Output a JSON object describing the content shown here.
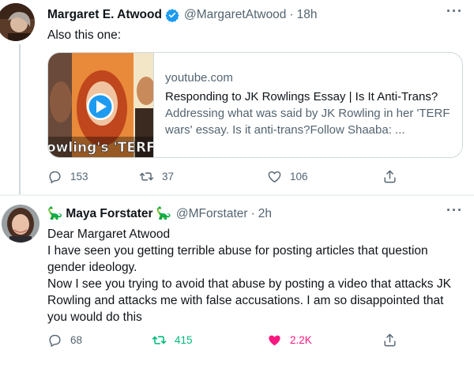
{
  "tweet1": {
    "name": "Margaret E. Atwood",
    "handle": "@MargaretAtwood",
    "separator": "·",
    "time": "18h",
    "more": "···",
    "text": "Also this one:",
    "card": {
      "thumb_text": "owling's 'TERF W",
      "domain": "youtube.com",
      "title": "Responding to JK Rowlings Essay | Is It Anti-Trans?",
      "description_line1": "Addressing what was said by JK Rowling in her 'TERF",
      "description_line2": "wars' essay. Is it anti-trans?Follow Shaaba: ..."
    },
    "actions": {
      "replies": "153",
      "retweets": "37",
      "likes": "106"
    }
  },
  "tweet2": {
    "name": "Maya Forstater",
    "name_emoji_left": "🦕",
    "name_emoji_right": "🦕",
    "handle": "@MForstater",
    "separator": "·",
    "time": "2h",
    "more": "···",
    "lines": [
      "Dear Margaret Atwood",
      "I have seen you getting terrible abuse for posting articles that question gender ideology.",
      "Now I see you trying to avoid that abuse by posting a video that attacks JK Rowling and attacks me with false accusations. I am so disappointed that you would do this"
    ],
    "actions": {
      "replies": "68",
      "retweets": "415",
      "likes": "2.2K"
    }
  },
  "colors": {
    "verified": "#1d9bf0",
    "retweeted": "#00ba7c",
    "liked": "#f91880",
    "muted": "#536471"
  }
}
